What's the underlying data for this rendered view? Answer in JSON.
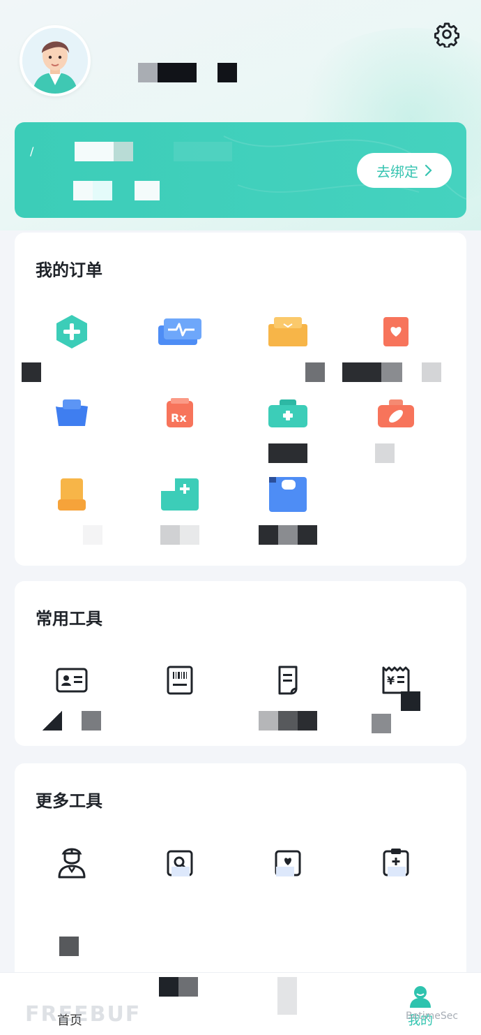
{
  "header": {
    "settings_icon": "gear-icon"
  },
  "bind_card": {
    "button_label": "去绑定",
    "accent": "#3ccdb8"
  },
  "orders": {
    "title": "我的订单",
    "items": [
      {
        "icon": "plus-hexagon-icon",
        "color": "#3ccdb8"
      },
      {
        "icon": "heartbeat-icon",
        "color": "#4e8df5"
      },
      {
        "icon": "box-icon",
        "color": "#f7b548"
      },
      {
        "icon": "heart-card-icon",
        "color": "#f7745b"
      },
      {
        "icon": "pill-bag-icon",
        "color": "#3f7ef0"
      },
      {
        "icon": "rx-icon",
        "color": "#f7745b"
      },
      {
        "icon": "medkit-icon",
        "color": "#3ccdb8"
      },
      {
        "icon": "medicine-case-icon",
        "color": "#f7745b"
      },
      {
        "icon": "document-icon",
        "color": "#f7b548"
      },
      {
        "icon": "plus-card-icon",
        "color": "#3ccdb8"
      },
      {
        "icon": "bed-icon",
        "color": "#4e8df5"
      }
    ]
  },
  "tools": {
    "title": "常用工具",
    "items": [
      {
        "icon": "id-card-icon"
      },
      {
        "icon": "barcode-icon"
      },
      {
        "icon": "prescription-icon"
      },
      {
        "icon": "receipt-icon"
      }
    ]
  },
  "more_tools": {
    "title": "更多工具",
    "items": [
      {
        "icon": "doctor-icon"
      },
      {
        "icon": "search-card-icon"
      },
      {
        "icon": "heart-folder-icon"
      },
      {
        "icon": "clipboard-plus-icon"
      }
    ]
  },
  "tabbar": {
    "home_label": "首页",
    "mine_label": "我的",
    "active_color": "#2ec3ae"
  },
  "watermarks": {
    "freebuf": "FREEBUF",
    "wechat": "BetimeSec"
  }
}
